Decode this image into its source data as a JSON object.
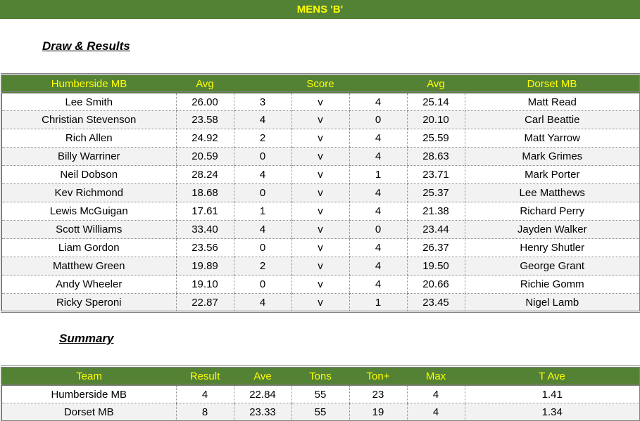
{
  "title": "MENS 'B'",
  "draw": {
    "heading": "Draw & Results",
    "headers": {
      "home_team": "Humberside MB",
      "home_avg": "Avg",
      "score": "Score",
      "away_avg": "Avg",
      "away_team": "Dorset MB"
    },
    "rows": [
      {
        "home": "Lee Smith",
        "home_avg": "26.00",
        "home_score": "3",
        "vs": "v",
        "away_score": "4",
        "away_avg": "25.14",
        "away": "Matt Read"
      },
      {
        "home": "Christian Stevenson",
        "home_avg": "23.58",
        "home_score": "4",
        "vs": "v",
        "away_score": "0",
        "away_avg": "20.10",
        "away": "Carl Beattie"
      },
      {
        "home": "Rich Allen",
        "home_avg": "24.92",
        "home_score": "2",
        "vs": "v",
        "away_score": "4",
        "away_avg": "25.59",
        "away": "Matt Yarrow"
      },
      {
        "home": "Billy Warriner",
        "home_avg": "20.59",
        "home_score": "0",
        "vs": "v",
        "away_score": "4",
        "away_avg": "28.63",
        "away": "Mark Grimes"
      },
      {
        "home": "Neil Dobson",
        "home_avg": "28.24",
        "home_score": "4",
        "vs": "v",
        "away_score": "1",
        "away_avg": "23.71",
        "away": "Mark Porter"
      },
      {
        "home": "Kev Richmond",
        "home_avg": "18.68",
        "home_score": "0",
        "vs": "v",
        "away_score": "4",
        "away_avg": "25.37",
        "away": "Lee Matthews"
      },
      {
        "home": "Lewis McGuigan",
        "home_avg": "17.61",
        "home_score": "1",
        "vs": "v",
        "away_score": "4",
        "away_avg": "21.38",
        "away": "Richard Perry"
      },
      {
        "home": "Scott Williams",
        "home_avg": "33.40",
        "home_score": "4",
        "vs": "v",
        "away_score": "0",
        "away_avg": "23.44",
        "away": "Jayden Walker"
      },
      {
        "home": "Liam Gordon",
        "home_avg": "23.56",
        "home_score": "0",
        "vs": "v",
        "away_score": "4",
        "away_avg": "26.37",
        "away": "Henry Shutler"
      },
      {
        "home": "Matthew Green",
        "home_avg": "19.89",
        "home_score": "2",
        "vs": "v",
        "away_score": "4",
        "away_avg": "19.50",
        "away": "George Grant"
      },
      {
        "home": "Andy Wheeler",
        "home_avg": "19.10",
        "home_score": "0",
        "vs": "v",
        "away_score": "4",
        "away_avg": "20.66",
        "away": "Richie Gomm"
      },
      {
        "home": "Ricky Speroni",
        "home_avg": "22.87",
        "home_score": "4",
        "vs": "v",
        "away_score": "1",
        "away_avg": "23.45",
        "away": "Nigel Lamb"
      }
    ]
  },
  "summary": {
    "heading": "Summary",
    "headers": [
      "Team",
      "Result",
      "Ave",
      "Tons",
      "Ton+",
      "Max",
      "T Ave"
    ],
    "rows": [
      [
        "Humberside MB",
        "4",
        "22.84",
        "55",
        "23",
        "4",
        "1.41"
      ],
      [
        "Dorset MB",
        "8",
        "23.33",
        "55",
        "19",
        "4",
        "1.34"
      ]
    ]
  },
  "colors": {
    "header_bg": "#548235",
    "header_text": "#ffff00",
    "alt_row": "#f2f2f2"
  }
}
